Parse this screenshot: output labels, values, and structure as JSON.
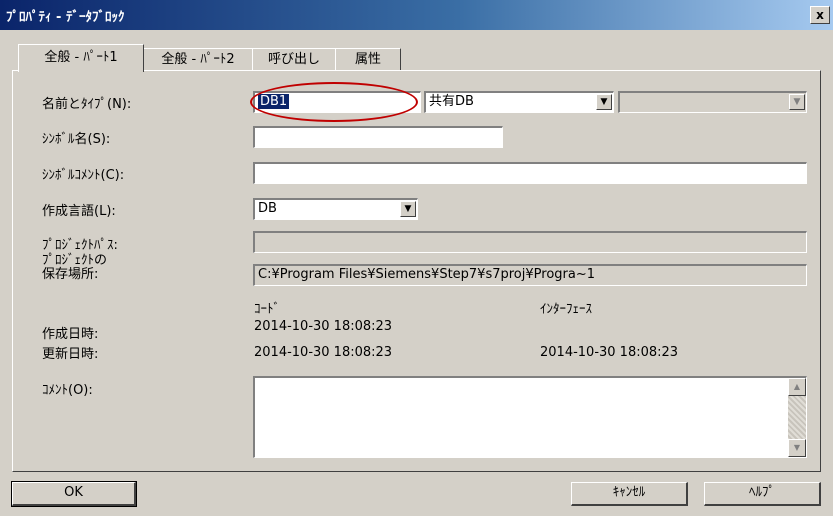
{
  "window": {
    "title": "ﾌﾟﾛﾊﾟﾃｨ - ﾃﾞｰﾀﾌﾞﾛｯｸ",
    "close_label": "x"
  },
  "tabs": [
    {
      "label": "全般 - ﾊﾟｰﾄ1",
      "active": true
    },
    {
      "label": "全般 - ﾊﾟｰﾄ2",
      "active": false
    },
    {
      "label": "呼び出し",
      "active": false
    },
    {
      "label": "属性",
      "active": false
    }
  ],
  "form": {
    "name_type": {
      "label": "名前とﾀｲﾌﾟ(N):",
      "name_value": "DB1",
      "type_value": "共有DB",
      "extra_value": ""
    },
    "symbol_name": {
      "label": "ｼﾝﾎﾞﾙ名(S):",
      "value": ""
    },
    "symbol_comment": {
      "label": "ｼﾝﾎﾞﾙｺﾒﾝﾄ(C):",
      "value": ""
    },
    "language": {
      "label": "作成言語(L):",
      "value": "DB"
    },
    "project_path": {
      "label": "ﾌﾟﾛｼﾞｪｸﾄﾊﾟｽ:",
      "value": ""
    },
    "project_storage": {
      "label_line1": "ﾌﾟﾛｼﾞｪｸﾄの",
      "label_line2": "保存場所:",
      "value": "C:¥Program Files¥Siemens¥Step7¥s7proj¥Progra~1"
    },
    "dates": {
      "col_code": "ｺｰﾄﾞ",
      "col_interface": "ｲﾝﾀｰﾌｪｰｽ",
      "created_label": "作成日時:",
      "created_code": "2014-10-30 18:08:23",
      "modified_label": "更新日時:",
      "modified_code": "2014-10-30 18:08:23",
      "modified_interface": "2014-10-30 18:08:23"
    },
    "comment": {
      "label": "ｺﾒﾝﾄ(O):",
      "value": ""
    }
  },
  "buttons": {
    "ok": "OK",
    "cancel": "ｷｬﾝｾﾙ",
    "help": "ﾍﾙﾌﾟ"
  },
  "icons": {
    "dropdown": "▼",
    "scroll_up": "▲",
    "scroll_down": "▼"
  },
  "annotation": {
    "color": "#c00000",
    "shape": "ellipse"
  }
}
